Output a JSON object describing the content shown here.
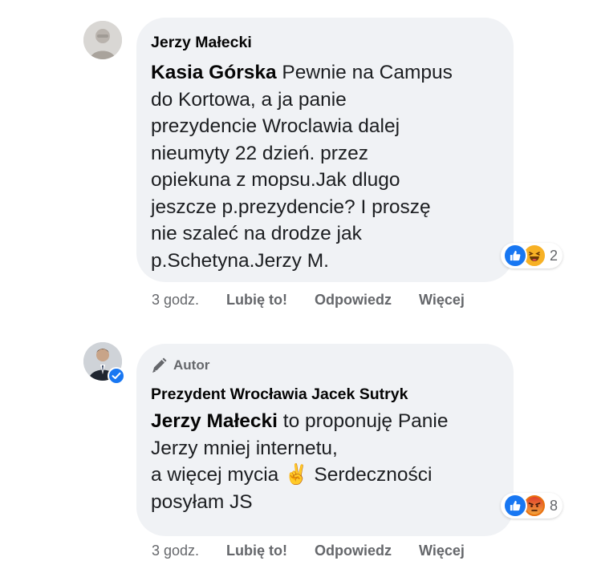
{
  "comments": [
    {
      "author": "Jerzy Małecki",
      "mention": "Kasia Górska",
      "lines": [
        " Pewnie na Campus",
        "do Kortowa, a ja panie",
        "prezydencie Wroclawia dalej",
        "nieumyty 22 dzień. przez",
        "opiekuna z mopsu.Jak dlugo",
        "jeszcze p.prezydencie? I proszę",
        "nie szaleć na drodze jak",
        "p.Schetyna.Jerzy M."
      ],
      "reactions": {
        "icons": [
          "like-icon",
          "haha-icon"
        ],
        "count": "2"
      },
      "actions": {
        "time": "3 godz.",
        "like": "Lubię to!",
        "reply": "Odpowiedz",
        "more": "Więcej"
      }
    },
    {
      "badge": "Autor",
      "author": "Prezydent Wrocławia Jacek Sutryk",
      "mention": "Jerzy Małecki",
      "lines": [
        " to proponuję Panie",
        "Jerzy mniej internetu,",
        "a więcej mycia ✌️ Serdeczności",
        "posyłam JS"
      ],
      "reactions": {
        "icons": [
          "like-icon",
          "angry-icon"
        ],
        "count": "8"
      },
      "actions": {
        "time": "3 godz.",
        "like": "Lubię to!",
        "reply": "Odpowiedz",
        "more": "Więcej"
      }
    }
  ],
  "colors": {
    "bubble": "#f0f2f5",
    "secondary_text": "#65676b",
    "like_blue": "#1877f2",
    "haha_yellow": "#f7b125",
    "angry_orange": "#e9710f"
  }
}
